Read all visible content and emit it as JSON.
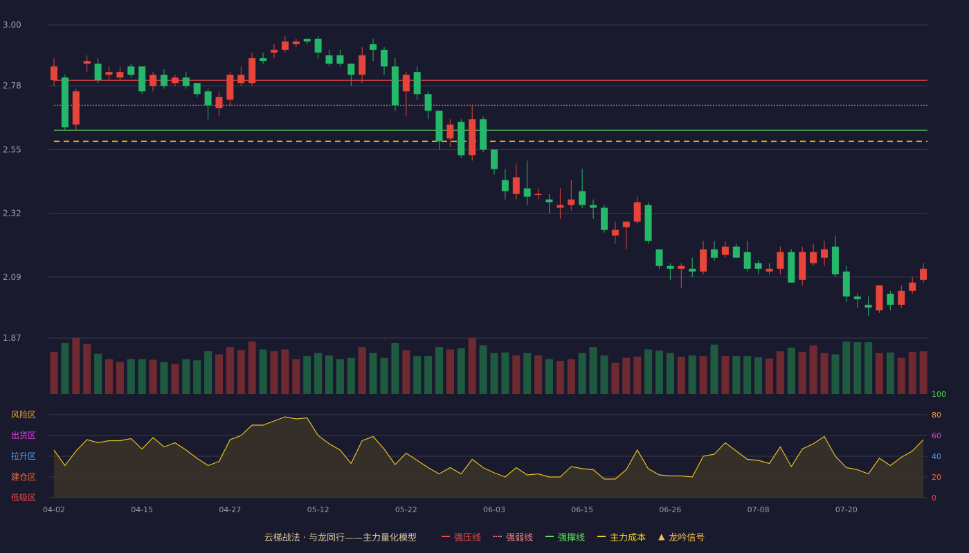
{
  "chart_data": {
    "type": "candlestick",
    "title": "云梯战法 · 与龙同行——主力量化模型",
    "price_axis": {
      "ylim": [
        1.87,
        3.0
      ],
      "ticks": [
        "3.00",
        "2.78",
        "2.55",
        "2.32",
        "2.09",
        "1.87"
      ]
    },
    "indicator_axis": {
      "ylim": [
        0,
        100
      ],
      "ticks": [
        "100",
        "80",
        "60",
        "40",
        "20",
        "0"
      ]
    },
    "zones": [
      "风险区",
      "出货区",
      "拉升区",
      "建仓区",
      "低吸区"
    ],
    "x_labels": [
      "04-02",
      "04-15",
      "04-27",
      "05-12",
      "05-22",
      "06-03",
      "06-15",
      "06-26",
      "07-08",
      "07-20"
    ],
    "x_label_index": [
      0,
      8,
      16,
      24,
      32,
      40,
      48,
      56,
      64,
      72
    ],
    "lines": {
      "strong_pressure": 2.8,
      "strong_weak": 2.71,
      "strong_support": 2.62,
      "main_cost": 2.58
    },
    "legend": [
      {
        "label": "强压线",
        "color": "#f04848",
        "style": "solid"
      },
      {
        "label": "强弱线",
        "color": "#f08080",
        "style": "dotted"
      },
      {
        "label": "强撑线",
        "color": "#5ee05e",
        "style": "solid"
      },
      {
        "label": "主力成本",
        "color": "#f0d020",
        "style": "dashed"
      },
      {
        "label": "龙吟信号",
        "color": "#f0c04a",
        "style": "triangle"
      }
    ],
    "ohlc": [
      [
        2.8,
        2.85,
        2.78,
        2.88
      ],
      [
        2.81,
        2.63,
        2.62,
        2.82
      ],
      [
        2.64,
        2.76,
        2.62,
        2.77
      ],
      [
        2.86,
        2.87,
        2.83,
        2.89
      ],
      [
        2.86,
        2.8,
        2.79,
        2.88
      ],
      [
        2.82,
        2.83,
        2.8,
        2.85
      ],
      [
        2.81,
        2.83,
        2.8,
        2.85
      ],
      [
        2.85,
        2.82,
        2.81,
        2.86
      ],
      [
        2.85,
        2.76,
        2.75,
        2.85
      ],
      [
        2.78,
        2.82,
        2.76,
        2.83
      ],
      [
        2.82,
        2.78,
        2.77,
        2.84
      ],
      [
        2.79,
        2.81,
        2.78,
        2.82
      ],
      [
        2.81,
        2.78,
        2.77,
        2.83
      ],
      [
        2.79,
        2.75,
        2.74,
        2.79
      ],
      [
        2.76,
        2.71,
        2.66,
        2.77
      ],
      [
        2.7,
        2.74,
        2.67,
        2.76
      ],
      [
        2.73,
        2.82,
        2.71,
        2.83
      ],
      [
        2.79,
        2.82,
        2.78,
        2.85
      ],
      [
        2.79,
        2.88,
        2.78,
        2.9
      ],
      [
        2.88,
        2.87,
        2.86,
        2.9
      ],
      [
        2.9,
        2.91,
        2.88,
        2.93
      ],
      [
        2.91,
        2.94,
        2.9,
        2.96
      ],
      [
        2.93,
        2.94,
        2.92,
        2.95
      ],
      [
        2.95,
        2.94,
        2.93,
        2.95
      ],
      [
        2.95,
        2.9,
        2.88,
        2.96
      ],
      [
        2.89,
        2.86,
        2.85,
        2.91
      ],
      [
        2.89,
        2.86,
        2.85,
        2.91
      ],
      [
        2.86,
        2.82,
        2.78,
        2.86
      ],
      [
        2.82,
        2.89,
        2.79,
        2.92
      ],
      [
        2.93,
        2.91,
        2.87,
        2.95
      ],
      [
        2.91,
        2.85,
        2.82,
        2.92
      ],
      [
        2.85,
        2.71,
        2.69,
        2.88
      ],
      [
        2.76,
        2.82,
        2.67,
        2.83
      ],
      [
        2.83,
        2.75,
        2.73,
        2.85
      ],
      [
        2.75,
        2.69,
        2.66,
        2.76
      ],
      [
        2.69,
        2.58,
        2.55,
        2.69
      ],
      [
        2.59,
        2.64,
        2.56,
        2.66
      ],
      [
        2.65,
        2.53,
        2.52,
        2.66
      ],
      [
        2.53,
        2.66,
        2.51,
        2.71
      ],
      [
        2.66,
        2.55,
        2.54,
        2.67
      ],
      [
        2.55,
        2.48,
        2.46,
        2.55
      ],
      [
        2.44,
        2.4,
        2.37,
        2.48
      ],
      [
        2.39,
        2.45,
        2.37,
        2.5
      ],
      [
        2.41,
        2.38,
        2.35,
        2.51
      ],
      [
        2.39,
        2.39,
        2.37,
        2.41
      ],
      [
        2.37,
        2.36,
        2.32,
        2.39
      ],
      [
        2.34,
        2.35,
        2.3,
        2.41
      ],
      [
        2.35,
        2.37,
        2.33,
        2.44
      ],
      [
        2.4,
        2.35,
        2.34,
        2.48
      ],
      [
        2.35,
        2.34,
        2.3,
        2.37
      ],
      [
        2.34,
        2.26,
        2.25,
        2.35
      ],
      [
        2.24,
        2.26,
        2.21,
        2.29
      ],
      [
        2.27,
        2.29,
        2.19,
        2.29
      ],
      [
        2.29,
        2.36,
        2.28,
        2.38
      ],
      [
        2.35,
        2.22,
        2.21,
        2.36
      ],
      [
        2.19,
        2.13,
        2.12,
        2.19
      ],
      [
        2.13,
        2.12,
        2.08,
        2.14
      ],
      [
        2.12,
        2.13,
        2.05,
        2.14
      ],
      [
        2.12,
        2.11,
        2.09,
        2.16
      ],
      [
        2.11,
        2.19,
        2.1,
        2.22
      ],
      [
        2.19,
        2.16,
        2.15,
        2.22
      ],
      [
        2.17,
        2.2,
        2.16,
        2.22
      ],
      [
        2.2,
        2.16,
        2.16,
        2.21
      ],
      [
        2.18,
        2.12,
        2.11,
        2.22
      ],
      [
        2.14,
        2.12,
        2.1,
        2.15
      ],
      [
        2.11,
        2.12,
        2.1,
        2.14
      ],
      [
        2.12,
        2.18,
        2.1,
        2.2
      ],
      [
        2.18,
        2.07,
        2.07,
        2.19
      ],
      [
        2.08,
        2.18,
        2.06,
        2.2
      ],
      [
        2.14,
        2.18,
        2.13,
        2.21
      ],
      [
        2.16,
        2.19,
        2.13,
        2.22
      ],
      [
        2.2,
        2.1,
        2.09,
        2.24
      ],
      [
        2.11,
        2.02,
        2.0,
        2.13
      ],
      [
        2.02,
        2.01,
        1.98,
        2.03
      ],
      [
        1.99,
        1.98,
        1.95,
        2.02
      ],
      [
        1.97,
        2.06,
        1.96,
        2.06
      ],
      [
        2.03,
        1.99,
        1.97,
        2.04
      ],
      [
        1.99,
        2.04,
        1.98,
        2.06
      ],
      [
        2.04,
        2.07,
        2.03,
        2.09
      ],
      [
        2.08,
        2.12,
        2.07,
        2.14
      ]
    ],
    "volume": [
      70,
      85,
      93,
      83,
      67,
      58,
      53,
      58,
      58,
      57,
      53,
      50,
      58,
      56,
      71,
      66,
      78,
      73,
      87,
      74,
      71,
      74,
      58,
      63,
      68,
      64,
      58,
      60,
      78,
      68,
      60,
      85,
      73,
      63,
      63,
      78,
      74,
      76,
      93,
      81,
      68,
      69,
      64,
      68,
      64,
      58,
      55,
      58,
      68,
      78,
      64,
      52,
      60,
      62,
      74,
      72,
      68,
      62,
      64,
      63,
      82,
      63,
      63,
      63,
      61,
      59,
      71,
      77,
      70,
      81,
      68,
      66,
      87,
      86,
      86,
      68,
      69,
      60,
      70,
      71
    ],
    "indicator": [
      46,
      31,
      45,
      56,
      53,
      55,
      55,
      57,
      47,
      58,
      49,
      53,
      46,
      38,
      31,
      35,
      56,
      60,
      70,
      70,
      74,
      78,
      76,
      77,
      60,
      52,
      46,
      33,
      55,
      59,
      47,
      32,
      43,
      36,
      29,
      23,
      29,
      23,
      37,
      29,
      24,
      20,
      29,
      22,
      23,
      20,
      20,
      30,
      28,
      27,
      18,
      18,
      27,
      46,
      28,
      22,
      21,
      21,
      20,
      40,
      42,
      53,
      45,
      37,
      36,
      33,
      49,
      30,
      47,
      52,
      59,
      40,
      29,
      27,
      23,
      38,
      31,
      39,
      45,
      56
    ]
  }
}
